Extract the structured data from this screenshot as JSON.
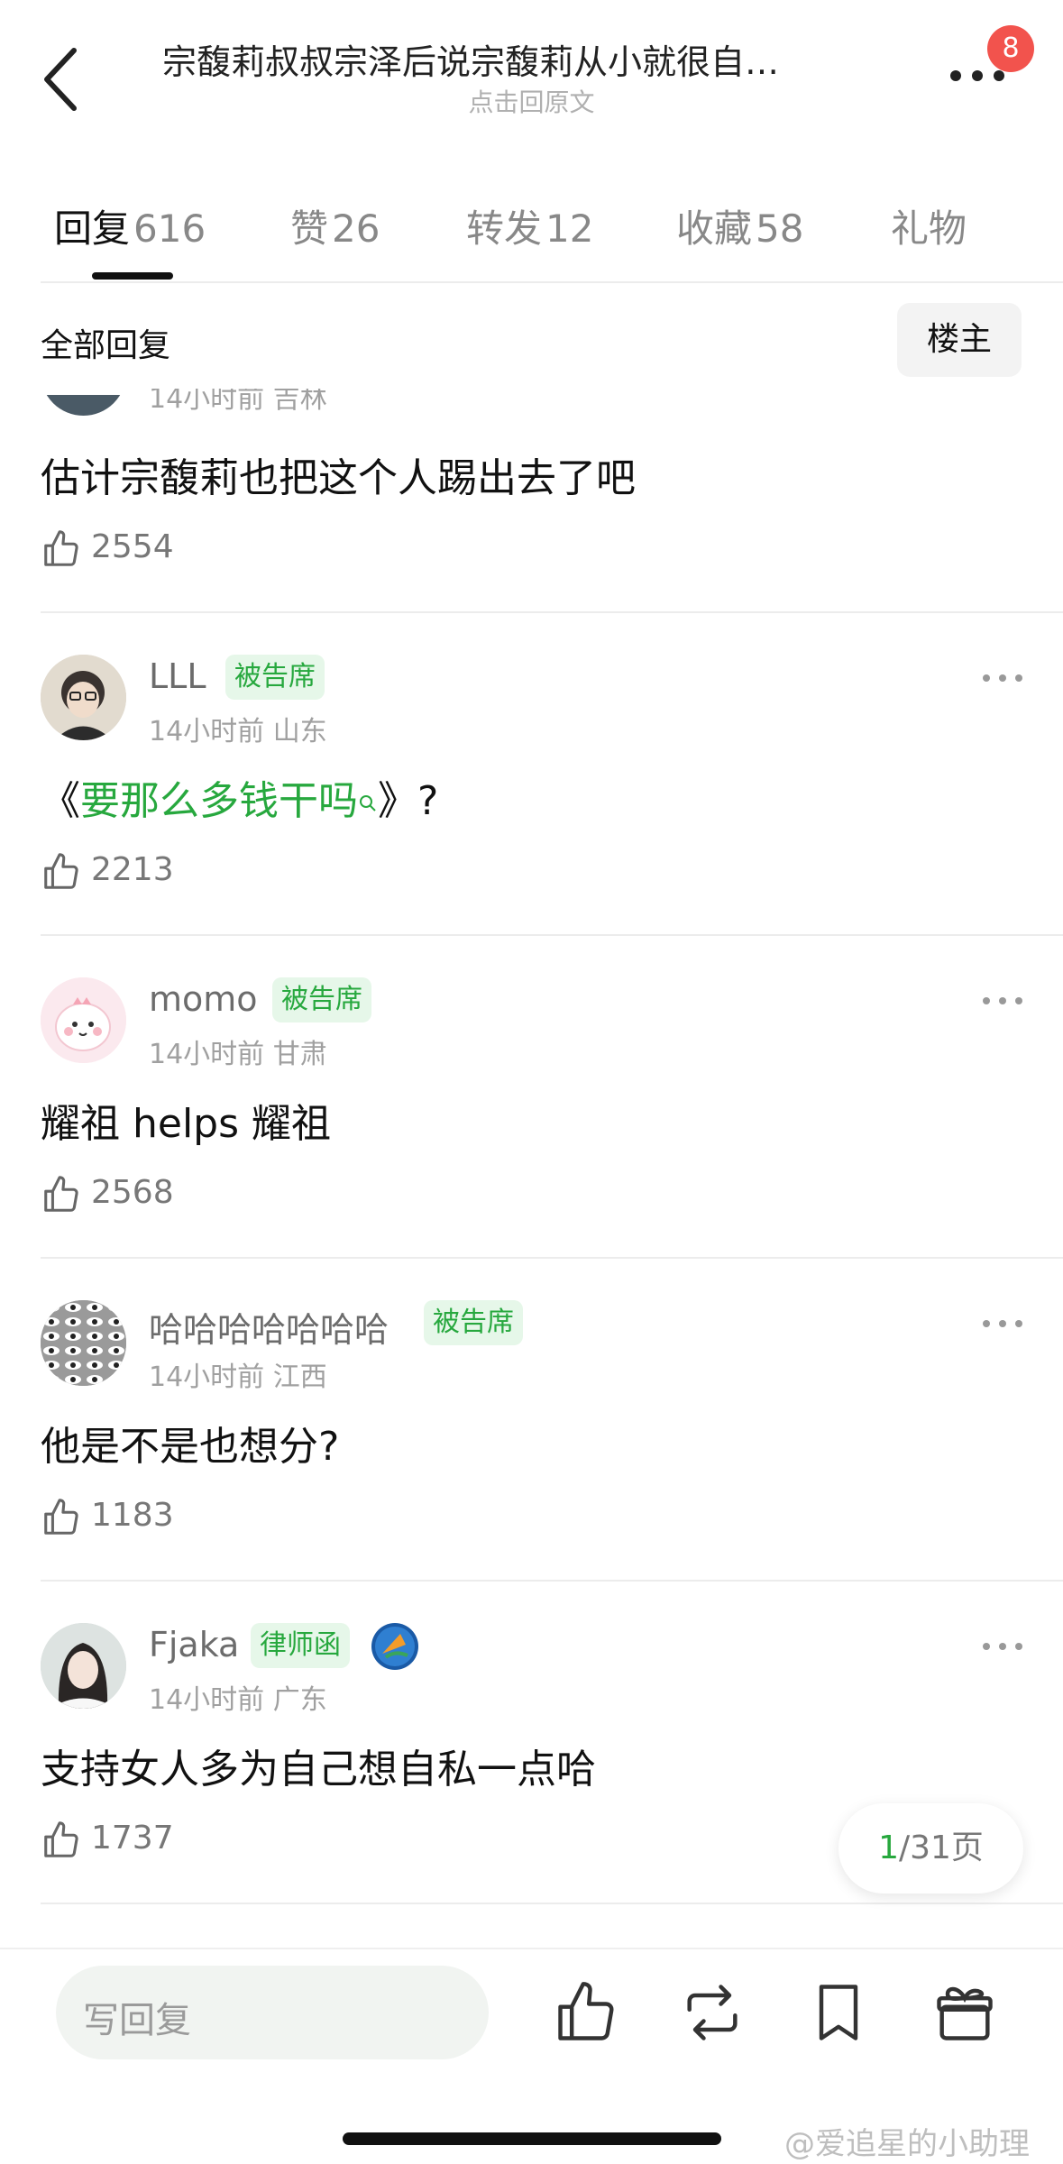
{
  "header": {
    "title": "宗馥莉叔叔宗泽后说宗馥莉从小就很自…",
    "subtitle": "点击回原文",
    "notification_count": "8"
  },
  "tabs": [
    {
      "label": "回复",
      "count": "616"
    },
    {
      "label": "赞",
      "count": "26"
    },
    {
      "label": "转发",
      "count": "12"
    },
    {
      "label": "收藏",
      "count": "58"
    },
    {
      "label": "礼物",
      "count": ""
    }
  ],
  "filter": {
    "label": "全部回复",
    "op_button": "楼主"
  },
  "comments": [
    {
      "username": "",
      "tag": "",
      "time": "14小时前",
      "location": "吉林",
      "text": "估计宗馥莉也把这个人踢出去了吧",
      "likes": "2554"
    },
    {
      "username": "LLL",
      "tag": "被告席",
      "time": "14小时前",
      "location": "山东",
      "text_prefix": "《",
      "text_link": "要那么多钱干吗",
      "text_suffix": "》?",
      "likes": "2213"
    },
    {
      "username": "momo",
      "tag": "被告席",
      "time": "14小时前",
      "location": "甘肃",
      "text": "耀祖 helps 耀祖",
      "likes": "2568"
    },
    {
      "username": "哈哈哈哈哈哈哈",
      "tag": "被告席",
      "time": "14小时前",
      "location": "江西",
      "text": "他是不是也想分?",
      "likes": "1183"
    },
    {
      "username": "Fjaka",
      "tag": "律师函",
      "time": "14小时前",
      "location": "广东",
      "text": "支持女人多为自己想自私一点哈",
      "likes": "1737"
    }
  ],
  "pager": {
    "current": "1",
    "total": "/31页"
  },
  "bottom_bar": {
    "reply_placeholder": "写回复",
    "icons": [
      "like-icon",
      "repost-icon",
      "bookmark-icon",
      "gift-icon"
    ]
  },
  "watermark": "@爱追星的小助理",
  "colors": {
    "accent_green": "#27a83e",
    "tag_bg": "#e6f7e9",
    "badge_red": "#f2534d"
  }
}
